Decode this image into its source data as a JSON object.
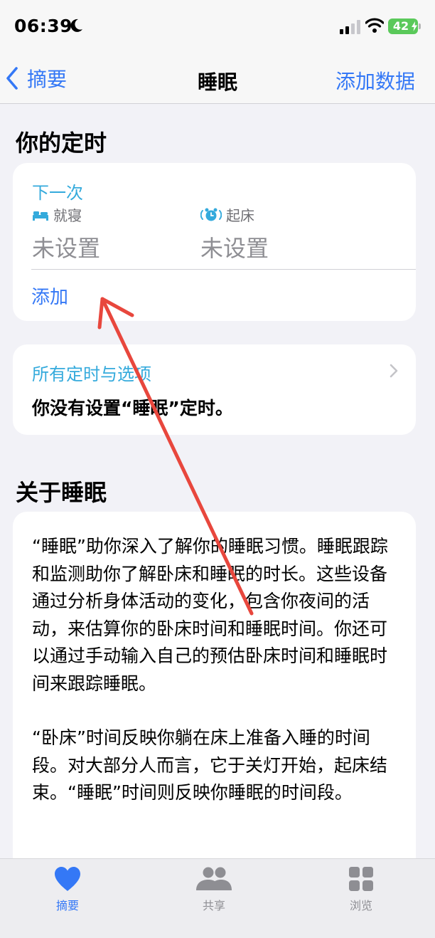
{
  "status_bar": {
    "time": "06:39",
    "battery": "42",
    "moon_icon": "moon-icon",
    "signal_icon": "cellular-signal-icon",
    "wifi_icon": "wifi-icon"
  },
  "nav": {
    "back_label": "摘要",
    "title": "睡眠",
    "add_data_label": "添加数据",
    "back_icon": "chevron-left-icon"
  },
  "schedule_section": {
    "heading": "你的定时",
    "next_label": "下一次",
    "bedtime": {
      "label": "就寝",
      "value": "未设置",
      "icon": "bed-icon"
    },
    "wake": {
      "label": "起床",
      "value": "未设置",
      "icon": "alarm-clock-icon"
    },
    "add_label": "添加"
  },
  "options_card": {
    "title": "所有定时与选项",
    "message": "你没有设置“睡眠”定时。",
    "chevron_icon": "chevron-right-icon"
  },
  "about_section": {
    "heading": "关于睡眠",
    "paragraph1": "“睡眠”助你深入了解你的睡眠习惯。睡眠跟踪和监测助你了解卧床和睡眠的时长。这些设备通过分析身体活动的变化，包含你夜间的活动，来估算你的卧床时间和睡眠时间。你还可以通过手动输入自己的预估卧床时间和睡眠时间来跟踪睡眠。",
    "paragraph2": "“卧床”时间反映你躺在床上准备入睡的时间段。对大部分人而言，它于关灯开始，起床结束。“睡眠”时间则反映你睡眠的时间段。"
  },
  "tab_bar": {
    "tabs": [
      {
        "label": "摘要",
        "icon": "heart-icon",
        "active": true
      },
      {
        "label": "共享",
        "icon": "people-icon",
        "active": false
      },
      {
        "label": "浏览",
        "icon": "grid-icon",
        "active": false
      }
    ]
  },
  "colors": {
    "accent": "#3478f6",
    "section_accent": "#34aadc",
    "annotation_arrow": "#e8473d",
    "battery": "#5ac95a"
  }
}
